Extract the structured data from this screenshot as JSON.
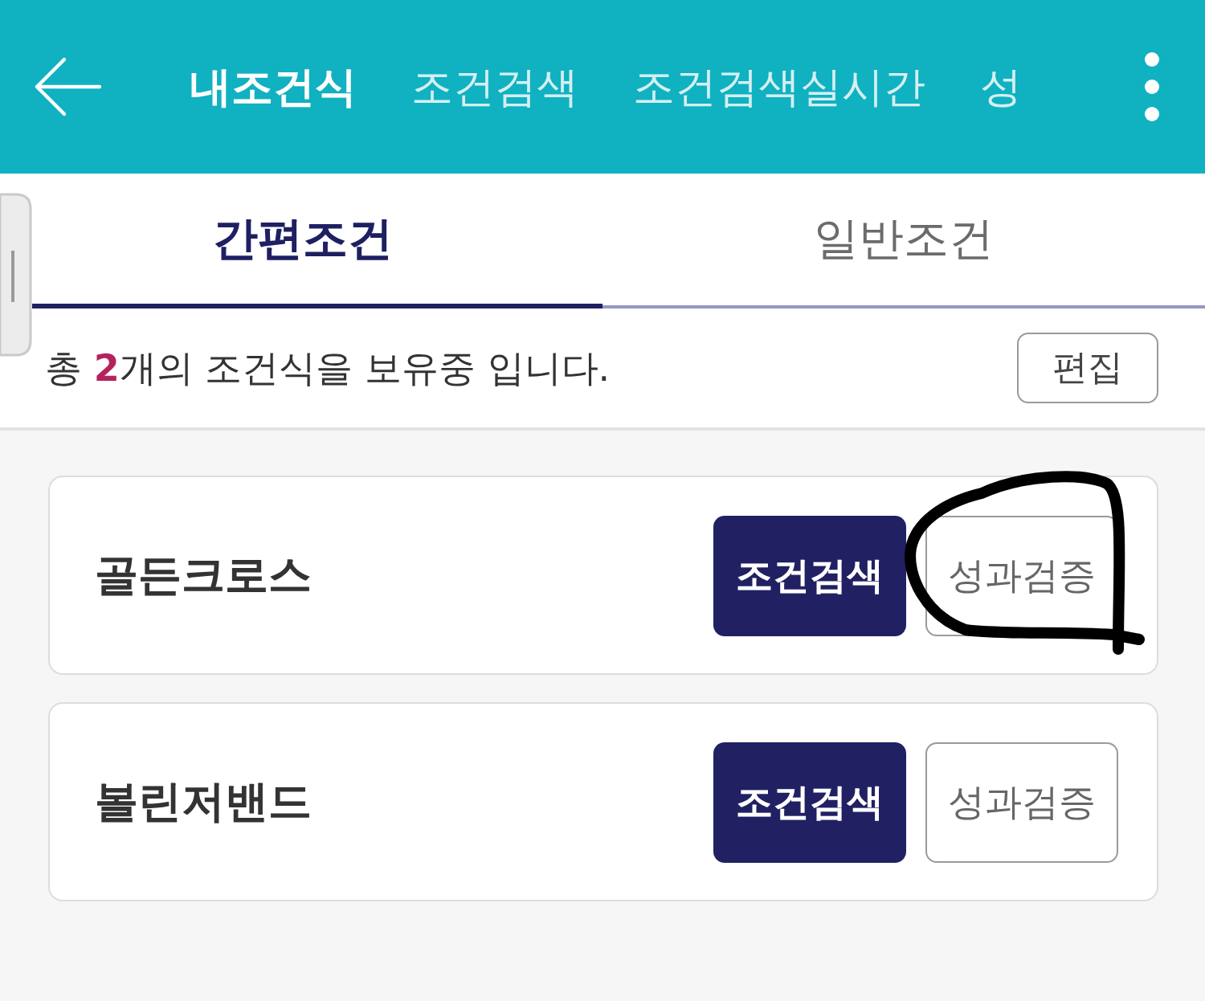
{
  "app_bar": {
    "tabs": [
      {
        "label": "내조건식",
        "selected": true
      },
      {
        "label": "조건검색",
        "selected": false
      },
      {
        "label": "조건검색실시간",
        "selected": false
      },
      {
        "label": "성",
        "selected": false
      }
    ]
  },
  "sub_tabs": [
    {
      "label": "간편조건",
      "selected": true
    },
    {
      "label": "일반조건",
      "selected": false
    }
  ],
  "summary": {
    "before": "총 ",
    "count": "2",
    "after": "개의 조건식을 보유중 입니다.",
    "edit_button": "편집"
  },
  "conditions": [
    {
      "name": "골든크로스",
      "circled": true,
      "buttons": [
        {
          "label": "조건검색",
          "kind": "primary"
        },
        {
          "label": "성과검증",
          "kind": "outline"
        }
      ]
    },
    {
      "name": "볼린저밴드",
      "circled": false,
      "buttons": [
        {
          "label": "조건검색",
          "kind": "primary"
        },
        {
          "label": "성과검증",
          "kind": "outline"
        }
      ]
    }
  ]
}
